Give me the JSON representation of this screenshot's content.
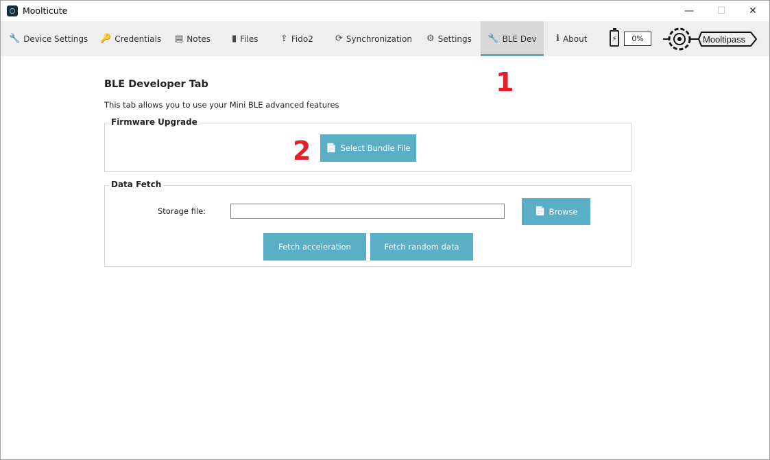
{
  "window": {
    "title": "Moolticute"
  },
  "tabs": [
    {
      "label": "Device Settings",
      "icon": "wrench-icon"
    },
    {
      "label": "Credentials",
      "icon": "key-icon"
    },
    {
      "label": "Notes",
      "icon": "newspaper-icon"
    },
    {
      "label": "Files",
      "icon": "file-icon"
    },
    {
      "label": "Fido2",
      "icon": "usb-icon"
    },
    {
      "label": "Synchronization",
      "icon": "refresh-icon"
    },
    {
      "label": "Settings",
      "icon": "gears-icon"
    },
    {
      "label": "BLE Dev",
      "icon": "wrench-icon",
      "active": true
    },
    {
      "label": "About",
      "icon": "info-icon"
    }
  ],
  "status": {
    "battery_percent": "0%"
  },
  "logo": {
    "text": "Mooltipass"
  },
  "annotations": {
    "one": "1",
    "two": "2"
  },
  "page": {
    "title": "BLE Developer Tab",
    "description": "This tab allows you to use your Mini BLE advanced features"
  },
  "firmware": {
    "legend": "Firmware Upgrade",
    "select_bundle_label": "Select Bundle File"
  },
  "data_fetch": {
    "legend": "Data Fetch",
    "storage_label": "Storage file:",
    "storage_value": "",
    "browse_label": "Browse",
    "fetch_accel_label": "Fetch acceleration",
    "fetch_random_label": "Fetch random data"
  },
  "colors": {
    "accent": "#5aafc7",
    "tab_active_underline": "#5aa9c1",
    "annotation_red": "#e0202a"
  }
}
